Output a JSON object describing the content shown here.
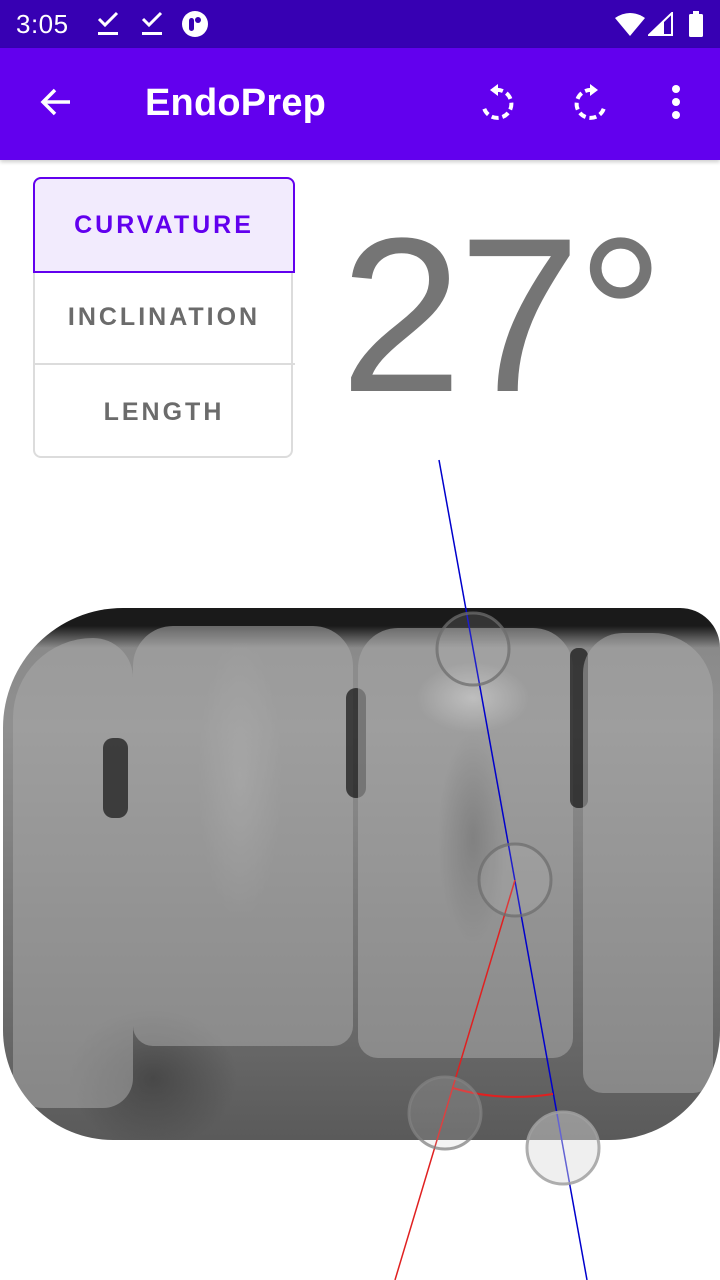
{
  "status_bar": {
    "time": "3:05",
    "left_icons": [
      "download-done-icon",
      "download-done-icon",
      "app-notification-icon"
    ],
    "right_icons": [
      "wifi-icon",
      "cellular-signal-icon",
      "battery-icon"
    ]
  },
  "app_bar": {
    "title": "EndoPrep",
    "back_icon": "arrow-back-icon",
    "actions": [
      "rotate-left-icon",
      "rotate-right-icon",
      "more-vert-icon"
    ]
  },
  "colors": {
    "primary": "#6200ee",
    "primary_dark": "#3700b3",
    "reference_line": "#0000cc",
    "measure_line": "#e02020"
  },
  "mode_toggle": {
    "options": [
      {
        "label": "CURVATURE",
        "selected": true
      },
      {
        "label": "INCLINATION",
        "selected": false
      },
      {
        "label": "LENGTH",
        "selected": false
      }
    ]
  },
  "measurement": {
    "value": "27°",
    "mode": "Curvature"
  },
  "image": {
    "description": "Dental periapical radiograph of lower molars",
    "handles": 4
  }
}
